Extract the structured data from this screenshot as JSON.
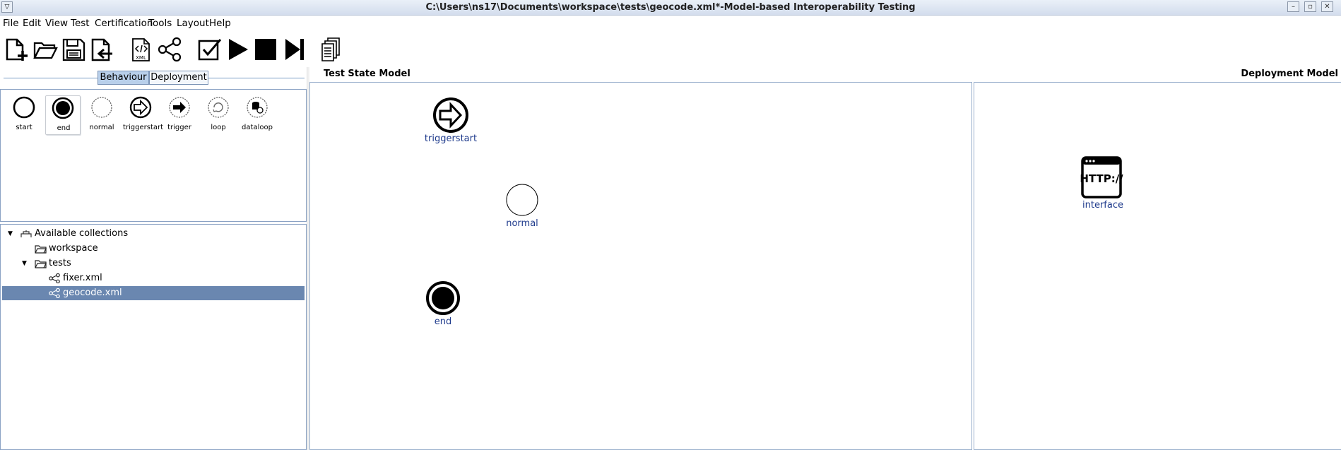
{
  "window": {
    "title": "C:\\Users\\ns17\\Documents\\workspace\\tests\\geocode.xml*-Model-based Interoperability Testing"
  },
  "menu": [
    "File",
    "Edit",
    "View",
    "Test",
    "Certification",
    "Tools",
    "Layout",
    "Help"
  ],
  "toolbar": {
    "xml_label": "XML",
    "icons": [
      "new-file-icon",
      "open-folder-icon",
      "save-icon",
      "import-icon",
      "xml-icon",
      "graph-icon",
      "validate-icon",
      "play-icon",
      "stop-icon",
      "step-icon",
      "documents-icon"
    ]
  },
  "tabs": {
    "behaviour": "Behaviour",
    "deployment": "Deployment",
    "active": "Behaviour"
  },
  "palette": [
    "start",
    "end",
    "normal",
    "triggerstart",
    "trigger",
    "loop",
    "dataloop"
  ],
  "tree": {
    "root": "Available collections",
    "workspace": "workspace",
    "tests": "tests",
    "fixer": "fixer.xml",
    "geocode": "geocode.xml",
    "selected": "geocode.xml"
  },
  "test_state_model": {
    "title": "Test State Model",
    "nodes": [
      {
        "type": "triggerstart",
        "label": "triggerstart"
      },
      {
        "type": "normal",
        "label": "normal"
      },
      {
        "type": "end",
        "label": "end"
      }
    ]
  },
  "deployment_model": {
    "title": "Deployment Model",
    "nodes": [
      {
        "type": "http-interface",
        "label": "interface",
        "icon_text": "HTTP://"
      }
    ]
  },
  "colors": {
    "label_blue": "#1e3a8c",
    "selection": "#6a87b0",
    "tab_active": "#b8cfea",
    "panel_border": "#8aa2c4"
  }
}
